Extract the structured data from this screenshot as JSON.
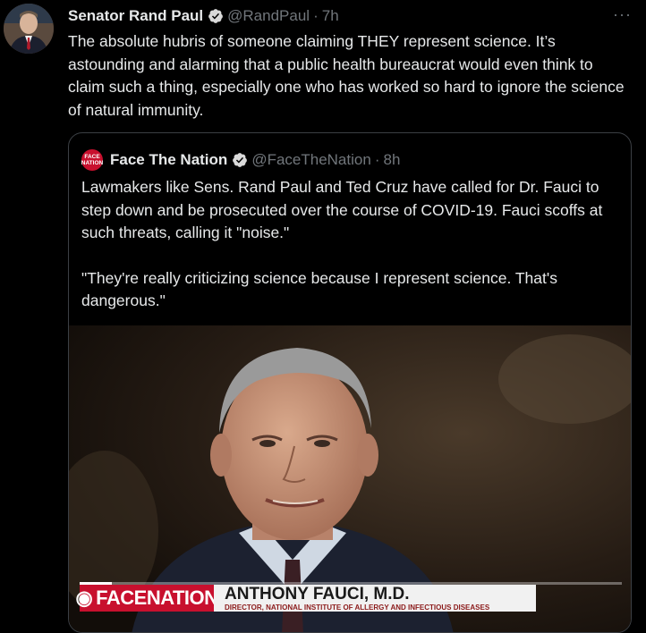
{
  "tweet": {
    "author_name": "Senator Rand Paul",
    "handle": "@RandPaul",
    "separator": "·",
    "time": "7h",
    "text": "The absolute hubris of someone claiming THEY represent science. It’s astounding and alarming that a public health bureaucrat would even think to claim such a thing, especially one who has worked so hard to ignore the science of natural immunity.",
    "more_icon": "···",
    "verified_color": "#d9d9d9"
  },
  "quote": {
    "author_name": "Face The Nation",
    "handle": "@FaceTheNation",
    "separator": "·",
    "time": "8h",
    "avatar_text_line1": "FACE",
    "avatar_text_line2": "NATION",
    "paragraph1": "Lawmakers like Sens. Rand Paul and Ted Cruz have called for Dr. Fauci to step down and be prosecuted over the course of COVID-19. Fauci scoffs at such threats, calling it \"noise.\"",
    "paragraph2": "\"They're really criticizing science because I represent science. That's dangerous.\"",
    "media": {
      "logo_text": "FACENATION",
      "lower_third_name": "ANTHONY FAUCI, M.D.",
      "lower_third_title": "DIRECTOR, NATIONAL INSTITUTE OF ALLERGY AND INFECTIOUS DISEASES",
      "progress_fraction": 0.06,
      "brand_color": "#c8102e"
    }
  }
}
